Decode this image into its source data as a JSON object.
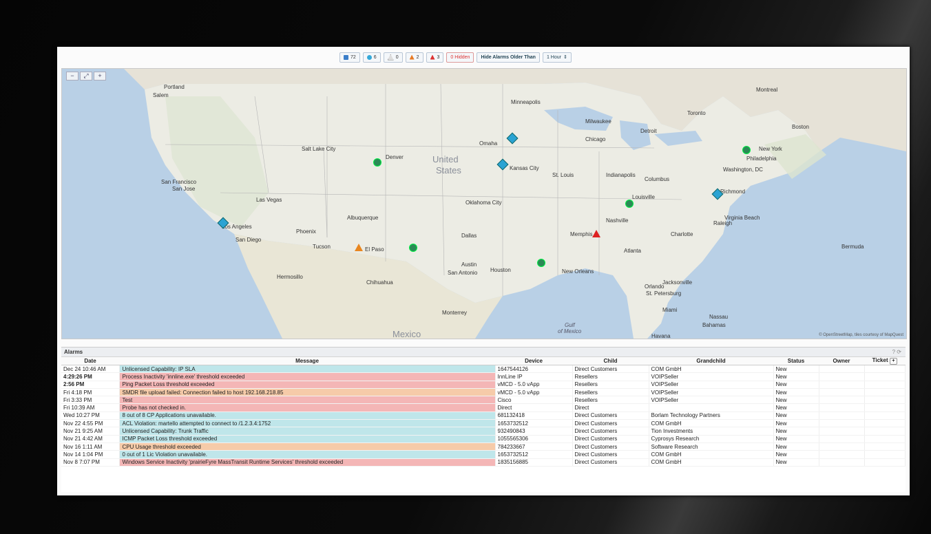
{
  "filterbar": {
    "info_count": "72",
    "clear_count": "6",
    "warning_count": "0",
    "major_count": "2",
    "critical_count": "3",
    "hidden_label": "0 Hidden",
    "hide_older_label": "Hide Alarms Older Than",
    "period_value": "1 Hour"
  },
  "map": {
    "zoom_out": "−",
    "zoom_reset": "⤢",
    "zoom_in": "+",
    "attribution": "© OpenStreetMap, tiles courtesy of MapQuest",
    "labels": {
      "united": "United",
      "states": "States",
      "portland": "Portland",
      "seattle_area": "Salem",
      "sanfrancisco": "San Francisco",
      "sanjose": "San Jose",
      "losangeles": "Los Angeles",
      "sandiego": "San Diego",
      "lasvegas": "Las Vegas",
      "phoenix": "Phoenix",
      "tucson": "Tucson",
      "elpaso": "El Paso",
      "saltlake": "Salt Lake City",
      "denver": "Denver",
      "albuquerque": "Albuquerque",
      "oklahoma": "Oklahoma City",
      "dallas": "Dallas",
      "austin": "Austin",
      "houston": "Houston",
      "sanantonio": "San Antonio",
      "monterrey": "Monterrey",
      "mexico": "Mexico",
      "gulf": "Gulf",
      "ofmexico": "of Mexico",
      "kansascity": "Kansas City",
      "omaha": "Omaha",
      "minneapolis": "Minneapolis",
      "chicago": "Chicago",
      "milwaukee": "Milwaukee",
      "detroit": "Detroit",
      "stlouis": "St. Louis",
      "memphis": "Memphis",
      "nashville": "Nashville",
      "atlanta": "Atlanta",
      "jacksonville": "Jacksonville",
      "neworleans": "New Orleans",
      "indianapolis": "Indianapolis",
      "columbus": "Columbus",
      "toronto": "Toronto",
      "montreal": "Montreal",
      "boston": "Boston",
      "newyork": "New York",
      "philadelphia": "Philadelphia",
      "washington": "Washington, DC",
      "richmond": "Richmond",
      "virginiabeach": "Virginia Beach",
      "raleigh": "Raleigh",
      "charlotte": "Charlotte",
      "louisville": "Louisville",
      "bermuda": "Bermuda",
      "nassau": "Nassau",
      "bahamas": "Bahamas",
      "havana": "Havana",
      "orlando": "Orlando",
      "miami": "Miami",
      "tampa": "St. Petersburg",
      "chihuahua": "Chihuahua",
      "hermosillo": "Hermosillo"
    }
  },
  "alarms": {
    "title": "Alarms",
    "help": "? ⟳",
    "columns": [
      "Date",
      "Message",
      "Device",
      "Child",
      "Grandchild",
      "Status",
      "Owner",
      "Ticket"
    ],
    "ticket_add": "+",
    "rows": [
      {
        "date": "Dec 24 10:46 AM",
        "message": "Unlicensed Capability: IP SLA",
        "device": "1647544126",
        "child": "Direct Customers",
        "grandchild": "COM GmbH",
        "status": "New",
        "owner": "",
        "ticket": "",
        "sev": "clear",
        "bold": false
      },
      {
        "date": "4:29:26 PM",
        "message": "Process Inactivity 'innline.exe' threshold exceeded",
        "device": "InnLine IP",
        "child": "Resellers",
        "grandchild": "VOIPSeller",
        "status": "New",
        "owner": "",
        "ticket": "",
        "sev": "crit",
        "bold": true
      },
      {
        "date": "2:56 PM",
        "message": "Ping Packet Loss threshold exceeded",
        "device": "vMCD - 5.0 vApp",
        "child": "Resellers",
        "grandchild": "VOIPSeller",
        "status": "New",
        "owner": "",
        "ticket": "",
        "sev": "crit",
        "bold": true
      },
      {
        "date": "Fri 4:18 PM",
        "message": "SMDR file upload failed: Connection failed to host 192.168.218.85",
        "device": "vMCD - 5.0 vApp",
        "child": "Resellers",
        "grandchild": "VOIPSeller",
        "status": "New",
        "owner": "",
        "ticket": "",
        "sev": "major",
        "bold": false
      },
      {
        "date": "Fri 3:33 PM",
        "message": "Test",
        "device": "Cisco",
        "child": "Resellers",
        "grandchild": "VOIPSeller",
        "status": "New",
        "owner": "",
        "ticket": "",
        "sev": "crit",
        "bold": false
      },
      {
        "date": "Fri 10:39 AM",
        "message": "Probe has not checked in.",
        "device": "Direct",
        "child": "Direct",
        "grandchild": "",
        "status": "New",
        "owner": "",
        "ticket": "",
        "sev": "crit",
        "bold": false
      },
      {
        "date": "Wed 10:27 PM",
        "message": "8 out of 8 CP Applications unavailable.",
        "device": "681132418",
        "child": "Direct Customers",
        "grandchild": "Borlam Technology Partners",
        "status": "New",
        "owner": "",
        "ticket": "",
        "sev": "clear",
        "bold": false
      },
      {
        "date": "Nov 22 4:55 PM",
        "message": "ACL Violation: martello attempted to connect to /1.2.3.4:1752",
        "device": "1653732512",
        "child": "Direct Customers",
        "grandchild": "COM GmbH",
        "status": "New",
        "owner": "",
        "ticket": "",
        "sev": "clear",
        "bold": false
      },
      {
        "date": "Nov 21 9:25 AM",
        "message": "Unlicensed Capability: Trunk Traffic",
        "device": "932490843",
        "child": "Direct Customers",
        "grandchild": "Tion Investments",
        "status": "New",
        "owner": "",
        "ticket": "",
        "sev": "clear",
        "bold": false
      },
      {
        "date": "Nov 21 4:42 AM",
        "message": "ICMP Packet Loss threshold exceeded",
        "device": "1055565306",
        "child": "Direct Customers",
        "grandchild": "Cyprosys Research",
        "status": "New",
        "owner": "",
        "ticket": "",
        "sev": "clear",
        "bold": false
      },
      {
        "date": "Nov 16 1:11 AM",
        "message": "CPU Usage threshold exceeded",
        "device": "784233667",
        "child": "Direct Customers",
        "grandchild": "Software Research",
        "status": "New",
        "owner": "",
        "ticket": "",
        "sev": "major",
        "bold": false
      },
      {
        "date": "Nov 14 1:04 PM",
        "message": "0 out of 1 Lic Violation unavailable.",
        "device": "1653732512",
        "child": "Direct Customers",
        "grandchild": "COM GmbH",
        "status": "New",
        "owner": "",
        "ticket": "",
        "sev": "clear",
        "bold": false
      },
      {
        "date": "Nov 8 7:07 PM",
        "message": "Windows Service Inactivity 'prairieFyre MassTransit Runtime Services' threshold exceeded",
        "device": "1835156885",
        "child": "Direct Customers",
        "grandchild": "COM GmbH",
        "status": "New",
        "owner": "",
        "ticket": "",
        "sev": "crit",
        "bold": false
      }
    ]
  }
}
